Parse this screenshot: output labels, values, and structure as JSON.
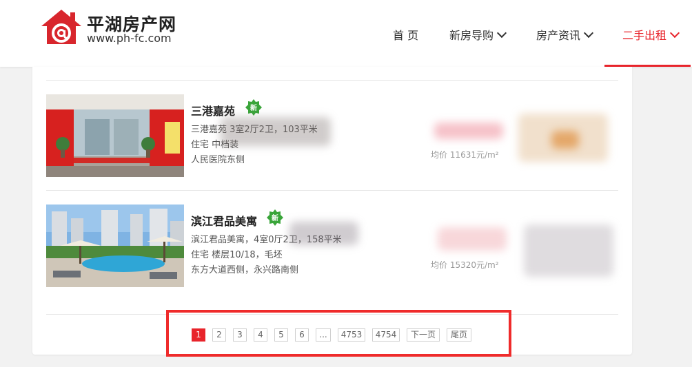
{
  "site": {
    "logo_name": "平湖房产网",
    "logo_url": "www.ph-fc.com",
    "brand_color": "#e8242b"
  },
  "nav": [
    {
      "label": "首 页"
    },
    {
      "label": "新房导购"
    },
    {
      "label": "房产资讯"
    },
    {
      "label": "二手出租"
    }
  ],
  "listings": [
    {
      "title": "三港嘉苑",
      "badge": "新",
      "line1": "三港嘉苑 3室2厅2卫，103平米",
      "line2": "住宅      中档装",
      "line3": "人民医院东侧",
      "price_label": "均价 11631元/m²"
    },
    {
      "title": "滨江君品美寓",
      "badge": "新",
      "line1": "滨江君品美寓，4室0厅2卫，158平米",
      "line2": "住宅  楼层10/18，毛坯",
      "line3": "东方大道西侧，永兴路南侧",
      "price_label": "均价 15320元/m²"
    }
  ],
  "pagination": {
    "pages": [
      "1",
      "2",
      "3",
      "4",
      "5",
      "6",
      "...",
      "4753",
      "4754"
    ],
    "current": "1",
    "next_label": "下一页",
    "last_label": "尾页"
  }
}
